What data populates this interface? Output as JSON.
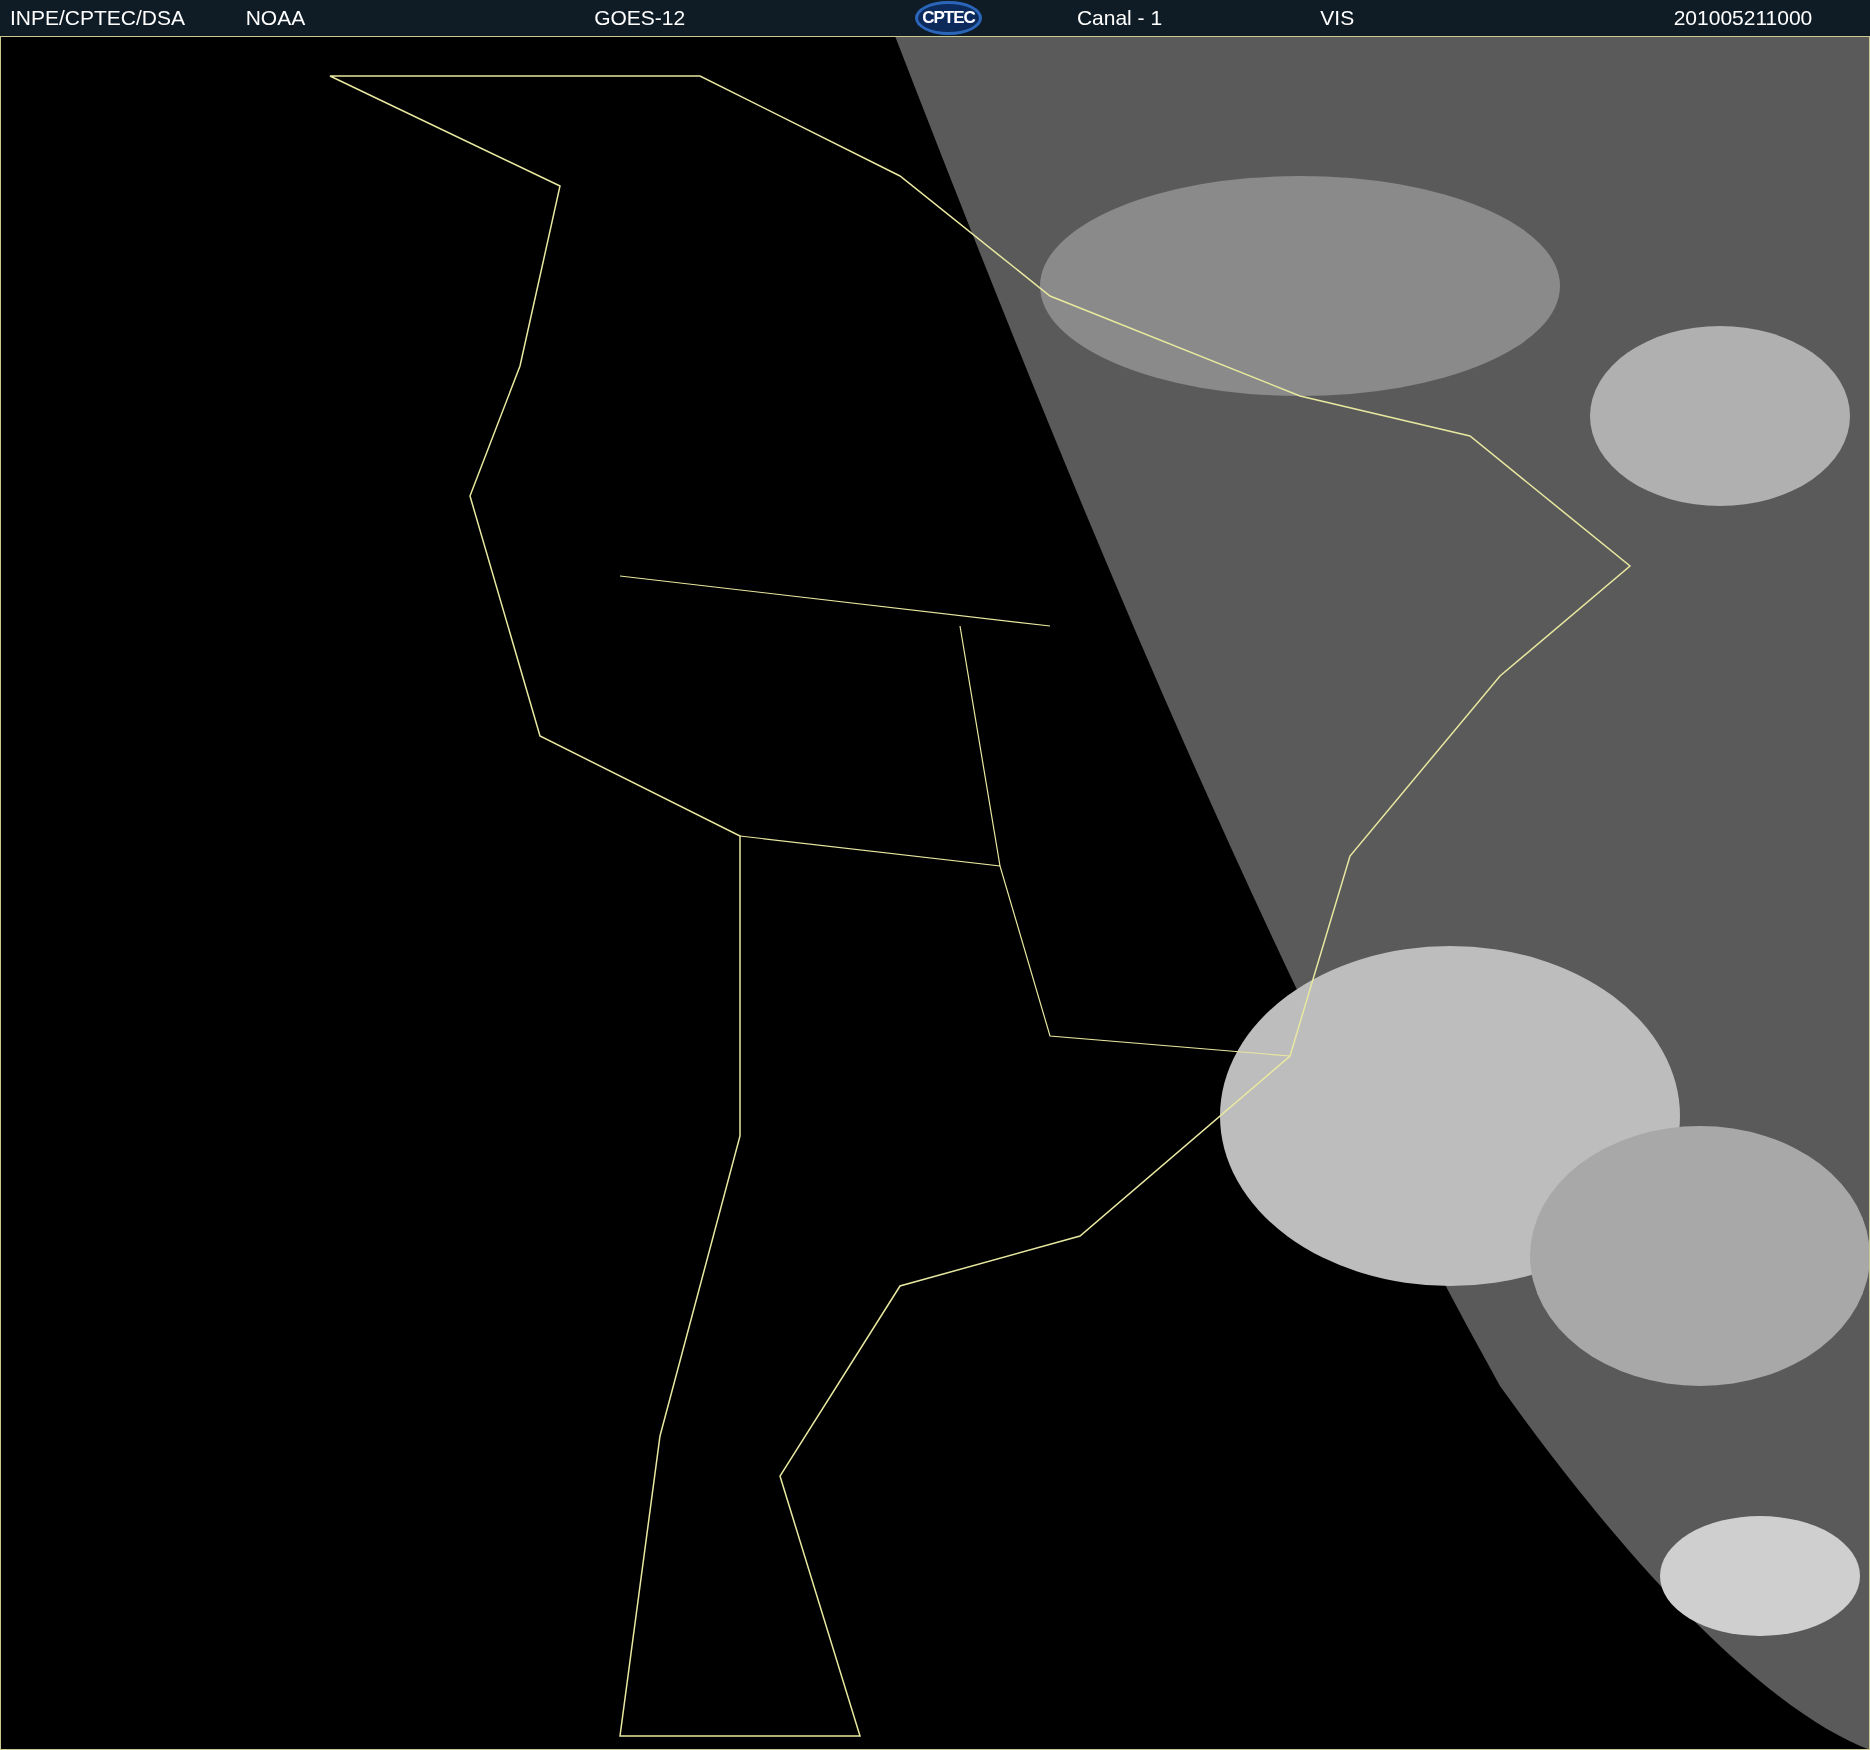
{
  "header": {
    "source": "INPE/CPTEC/DSA",
    "agency": "NOAA",
    "satellite": "GOES-12",
    "logo_text": "CPTEC",
    "channel": "Canal - 1",
    "band": "VIS",
    "timestamp": "201005211000"
  }
}
